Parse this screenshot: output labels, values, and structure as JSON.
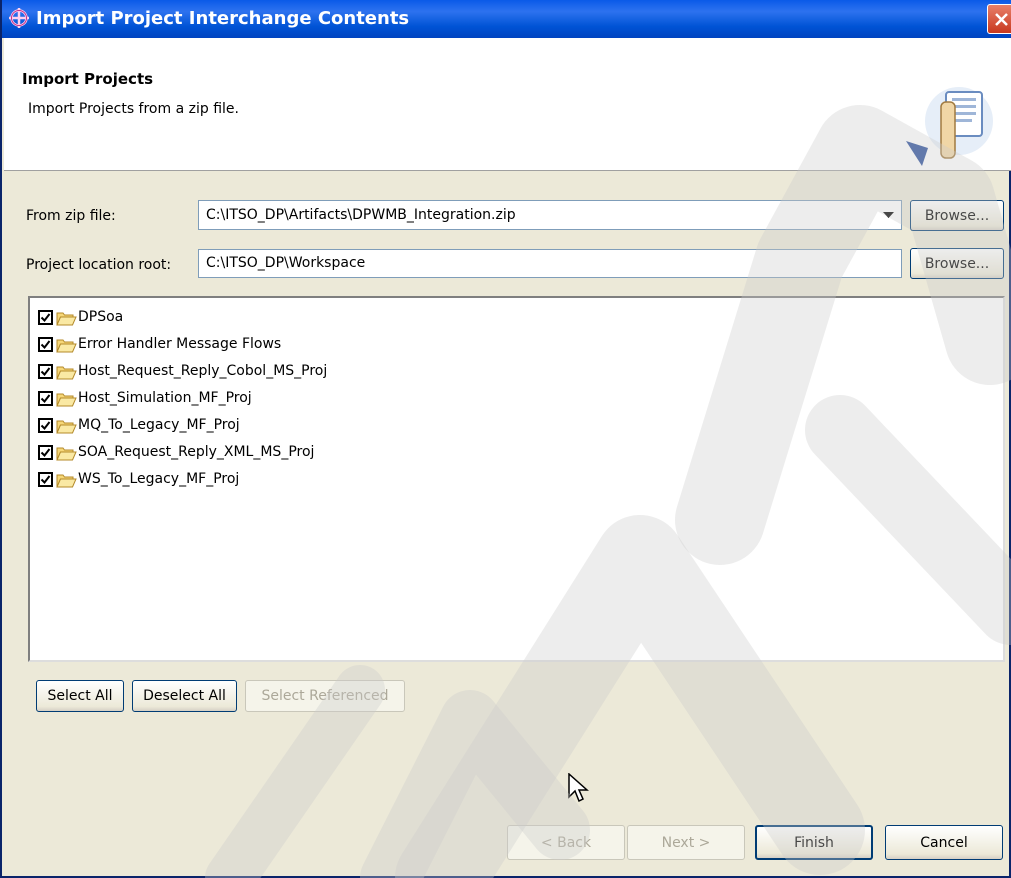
{
  "window": {
    "title": "Import Project Interchange Contents",
    "close_icon": "close-icon"
  },
  "header": {
    "title": "Import Projects",
    "description": "Import Projects from a zip file.",
    "icon": "wizard-import-icon"
  },
  "form": {
    "zip_label": "From zip file:",
    "zip_value": "C:\\ITSO_DP\\Artifacts\\DPWMB_Integration.zip",
    "location_label": "Project location root:",
    "location_value": "C:\\ITSO_DP\\Workspace",
    "browse_label": "Browse..."
  },
  "projects": [
    {
      "name": "DPSoa",
      "checked": true
    },
    {
      "name": "Error Handler Message Flows",
      "checked": true
    },
    {
      "name": "Host_Request_Reply_Cobol_MS_Proj",
      "checked": true
    },
    {
      "name": "Host_Simulation_MF_Proj",
      "checked": true
    },
    {
      "name": "MQ_To_Legacy_MF_Proj",
      "checked": true
    },
    {
      "name": "SOA_Request_Reply_XML_MS_Proj",
      "checked": true
    },
    {
      "name": "WS_To_Legacy_MF_Proj",
      "checked": true
    }
  ],
  "selection_buttons": {
    "select_all": "Select All",
    "deselect_all": "Deselect All",
    "select_referenced": "Select Referenced"
  },
  "footer": {
    "back": "< Back",
    "next": "Next >",
    "finish": "Finish",
    "cancel": "Cancel"
  },
  "colors": {
    "titlebar": "#0054e3",
    "dialog_bg": "#ece9d8",
    "button_border": "#003c74"
  }
}
